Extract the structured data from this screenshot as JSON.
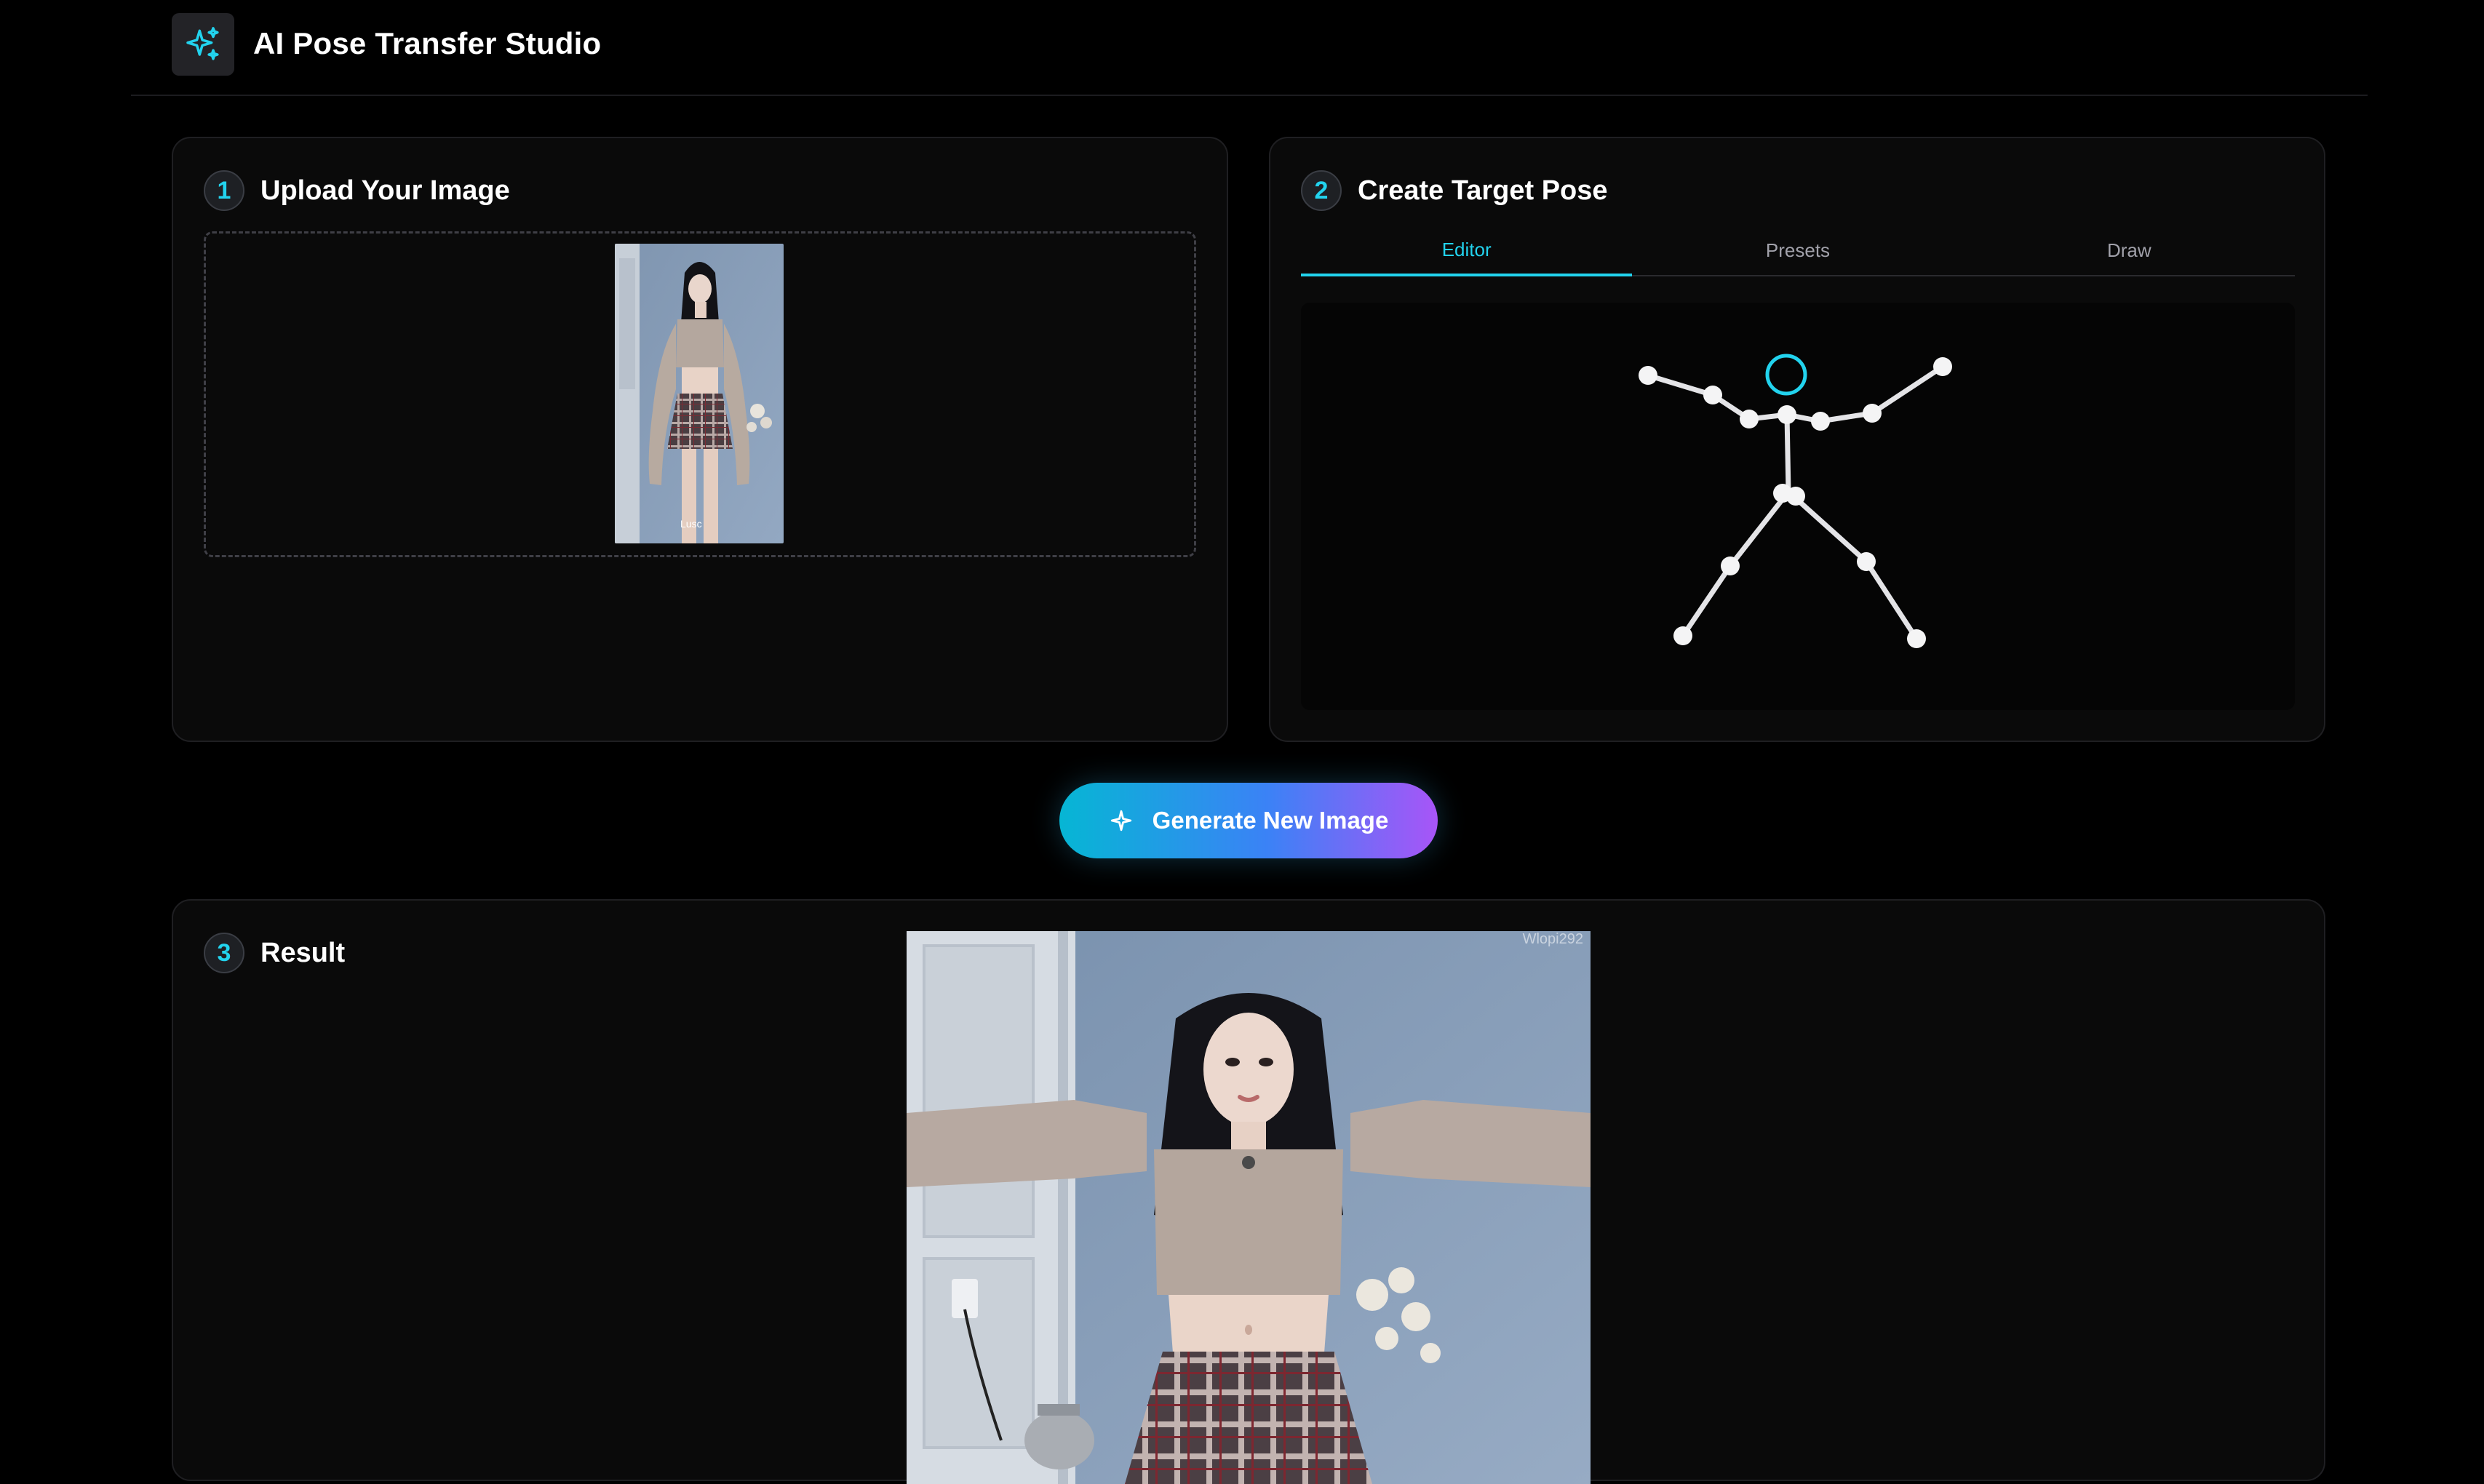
{
  "app": {
    "title": "AI Pose Transfer Studio",
    "logo_icon": "sparkles-icon"
  },
  "upload": {
    "step_number": "1",
    "title": "Upload Your Image",
    "preview_watermark": "Lusc"
  },
  "pose": {
    "step_number": "2",
    "title": "Create Target Pose",
    "tabs": [
      {
        "label": "Editor",
        "active": true
      },
      {
        "label": "Presets",
        "active": false
      },
      {
        "label": "Draw",
        "active": false
      }
    ],
    "head_color": "#22d3ee",
    "joint_color": "#f4f4f5"
  },
  "generate": {
    "label": "Generate New Image",
    "icon": "sparkle-icon"
  },
  "result": {
    "step_number": "3",
    "title": "Result",
    "watermark": "Wlopi292"
  },
  "colors": {
    "accent": "#22d3ee",
    "gradient_start": "#06b6d4",
    "gradient_end": "#a855f7",
    "background": "#000000",
    "card": "#0a0a0a"
  }
}
